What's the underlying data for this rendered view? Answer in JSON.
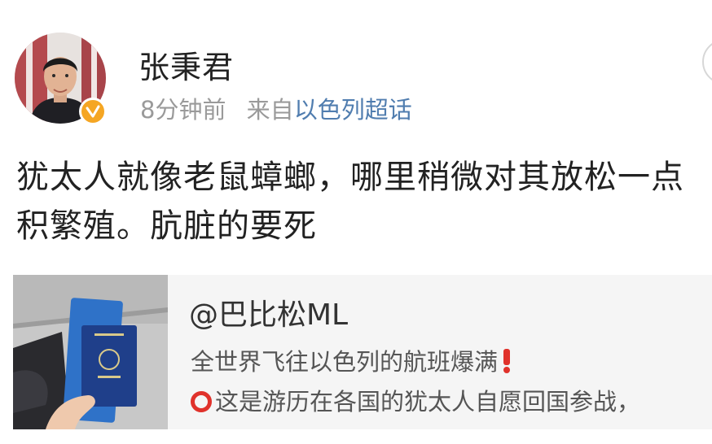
{
  "post": {
    "author": "张秉君",
    "time": "8分钟前",
    "source_prefix": "来自",
    "source_link": "以色列超话",
    "text_line1": "犹太人就像老鼠蟑螂，哪里稍微对其放松一点",
    "text_line2": "积繁殖。肮脏的要死"
  },
  "shared": {
    "user": "@巴比松ML",
    "line1": "全世界飞往以色列的航班爆满",
    "line2": "这是游历在各国的犹太人自愿回国参战，"
  },
  "colors": {
    "verified_badge": "#f5a623",
    "source_link": "#507daf",
    "emoji_red": "#e0322b",
    "card_bg": "#f5f5f5"
  },
  "icons": {
    "verified": "verified-v-icon",
    "exclamation": "red-exclamation-icon",
    "circle": "red-circle-icon"
  }
}
